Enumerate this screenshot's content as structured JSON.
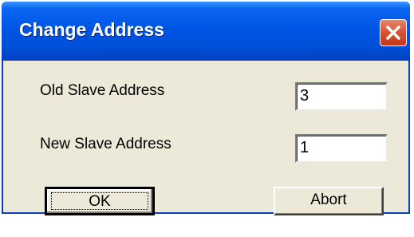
{
  "window": {
    "title": "Change Address"
  },
  "fields": {
    "old_label": "Old Slave Address",
    "old_value": "3",
    "new_label": "New Slave Address",
    "new_value": "1"
  },
  "buttons": {
    "ok_label": "OK",
    "abort_label": "Abort"
  },
  "icons": {
    "close": "close-icon"
  },
  "colors": {
    "titlebar": "#0055e5",
    "close_button": "#d9512f",
    "dialog_face": "#ece9d8"
  }
}
